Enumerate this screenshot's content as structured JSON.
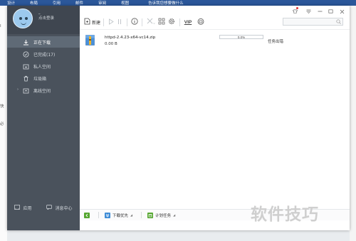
{
  "background": {
    "ribbon_items": [
      "设计",
      "布局",
      "引用",
      "邮件",
      "审阅",
      "视图"
    ],
    "ribbon_search": "告诉我您想要做什么",
    "left_chars": [
      "I",
      "快",
      "必"
    ]
  },
  "user": {
    "name": "_",
    "login_label": "点击登录"
  },
  "sidebar": {
    "items": [
      {
        "label": "正在下载",
        "icon": "download-icon"
      },
      {
        "label": "已完成(17)",
        "icon": "check-circle-icon"
      },
      {
        "label": "私人空间",
        "icon": "lock-folder-icon"
      },
      {
        "label": "垃圾箱",
        "icon": "trash-icon"
      },
      {
        "label": "离线空间",
        "icon": "cloud-folder-icon"
      }
    ],
    "bottom": {
      "apps_label": "应用",
      "messages_label": "消息中心"
    }
  },
  "toolbar": {
    "new_label": "新建",
    "vip_label": "VIP",
    "search_placeholder": ""
  },
  "task": {
    "filename": "httpd-2.4.23-x64-vc14.zip",
    "size": "0.00 B",
    "progress_text": "0.0%",
    "progress": 0,
    "status": "任务出错"
  },
  "statusbar": {
    "speed_priority_label": "下载优先",
    "scheduled_task_label": "计划任务"
  },
  "watermark": "软件技巧",
  "colors": {
    "sidebar": "#4a525c",
    "sidebar_active": "#5f6a76",
    "accent_blue": "#3d8bd6",
    "accent_green": "#55a630"
  }
}
